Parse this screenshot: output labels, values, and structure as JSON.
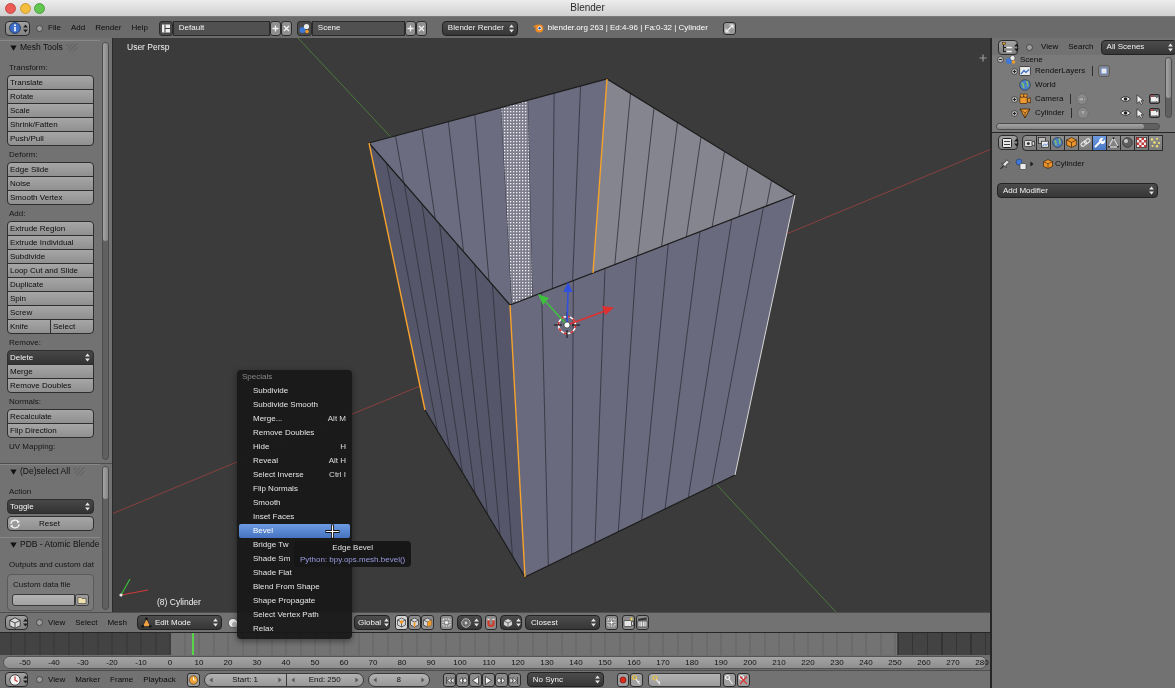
{
  "window": {
    "title": "Blender"
  },
  "info_header": {
    "menus": [
      "File",
      "Add",
      "Render",
      "Help"
    ],
    "screen_layout": "Default",
    "scene": "Scene",
    "render_engine": "Blender Render",
    "stats": "blender.org 263 | Ed:4-96 | Fa:0-32 | Cylinder"
  },
  "tool_shelf": {
    "panels": [
      {
        "title": "Mesh Tools",
        "expanded": true,
        "rows": [
          {
            "kind": "heading",
            "text": "Transform:"
          },
          {
            "kind": "column",
            "items": [
              {
                "kind": "button",
                "label": "Translate"
              },
              {
                "kind": "button",
                "label": "Rotate"
              },
              {
                "kind": "button",
                "label": "Scale"
              },
              {
                "kind": "button",
                "label": "Shrink/Fatten"
              },
              {
                "kind": "button",
                "label": "Push/Pull"
              }
            ]
          },
          {
            "kind": "heading",
            "text": "Deform:"
          },
          {
            "kind": "column",
            "items": [
              {
                "kind": "button",
                "label": "Edge Slide"
              },
              {
                "kind": "button",
                "label": "Noise"
              },
              {
                "kind": "button",
                "label": "Smooth Vertex"
              }
            ]
          },
          {
            "kind": "heading",
            "text": "Add:"
          },
          {
            "kind": "column",
            "items": [
              {
                "kind": "button",
                "label": "Extrude Region"
              },
              {
                "kind": "button",
                "label": "Extrude Individual"
              },
              {
                "kind": "button",
                "label": "Subdivide"
              },
              {
                "kind": "button",
                "label": "Loop Cut and Slide"
              },
              {
                "kind": "button",
                "label": "Duplicate"
              },
              {
                "kind": "button",
                "label": "Spin"
              },
              {
                "kind": "button",
                "label": "Screw"
              },
              {
                "kind": "pair",
                "labels": [
                  "Knife",
                  "Select"
                ]
              }
            ]
          },
          {
            "kind": "heading",
            "text": "Remove:"
          },
          {
            "kind": "column",
            "items": [
              {
                "kind": "dropdown",
                "label": "Delete"
              },
              {
                "kind": "button",
                "label": "Merge"
              },
              {
                "kind": "button",
                "label": "Remove Doubles"
              }
            ]
          },
          {
            "kind": "heading",
            "text": "Normals:"
          },
          {
            "kind": "column",
            "items": [
              {
                "kind": "button",
                "label": "Recalculate"
              },
              {
                "kind": "button",
                "label": "Flip Direction"
              }
            ]
          },
          {
            "kind": "heading",
            "text": "UV Mapping:"
          }
        ]
      },
      {
        "title": "(De)select All",
        "expanded": true,
        "rows": [
          {
            "kind": "heading",
            "text": "Action"
          },
          {
            "kind": "column",
            "items": [
              {
                "kind": "dropdown",
                "label": "Toggle"
              }
            ]
          },
          {
            "kind": "column",
            "items": [
              {
                "kind": "reset",
                "label": "Reset"
              }
            ]
          }
        ]
      },
      {
        "title": "PDB - Atomic Blende",
        "expanded": true,
        "rows": [
          {
            "kind": "heading",
            "text": "Outputs and custom dat"
          },
          {
            "kind": "file_box",
            "label": "Custom data file"
          }
        ]
      }
    ]
  },
  "viewport": {
    "view_name": "User Persp",
    "active_object": "(8) Cylinder"
  },
  "specials_menu": {
    "title": "Specials",
    "items": [
      {
        "label": "Subdivide",
        "selected": false
      },
      {
        "label": "Subdivide Smooth",
        "selected": false
      },
      {
        "label": "Merge...",
        "shortcut": "Alt M",
        "selected": false
      },
      {
        "label": "Remove Doubles",
        "selected": false
      },
      {
        "label": "Hide",
        "shortcut": "H",
        "selected": false
      },
      {
        "label": "Reveal",
        "shortcut": "Alt H",
        "selected": false
      },
      {
        "label": "Select Inverse",
        "shortcut": "Ctrl I",
        "selected": false
      },
      {
        "label": "Flip Normals",
        "selected": false
      },
      {
        "label": "Smooth",
        "selected": false
      },
      {
        "label": "Inset Faces",
        "selected": false
      },
      {
        "label": "Bevel",
        "selected": true
      },
      {
        "label": "Bridge Tw",
        "selected": false
      },
      {
        "label": "Shade Sm",
        "selected": false
      },
      {
        "label": "Shade Flat",
        "selected": false
      },
      {
        "label": "Blend From Shape",
        "selected": false
      },
      {
        "label": "Shape Propagate",
        "selected": false
      },
      {
        "label": "Select Vertex Path",
        "selected": false
      },
      {
        "label": "Relax",
        "selected": false
      }
    ]
  },
  "tooltip": {
    "title": "Edge Bevel",
    "python": "Python: bpy.ops.mesh.bevel()"
  },
  "view3d_header": {
    "menus": [
      "View",
      "Select",
      "Mesh"
    ],
    "mode": "Edit Mode",
    "orientation": "Global",
    "select_modes": [
      {
        "kind": "vertex",
        "selected": true
      },
      {
        "kind": "edge",
        "selected": false
      },
      {
        "kind": "face",
        "selected": false
      }
    ],
    "snap_target": "Closest"
  },
  "timeline": {
    "ruler_labels": [
      "-50",
      "-40",
      "-30",
      "-20",
      "-10",
      "0",
      "10",
      "20",
      "30",
      "40",
      "50",
      "60",
      "70",
      "80",
      "90",
      "100",
      "110",
      "120",
      "130",
      "140",
      "150",
      "160",
      "170",
      "180",
      "190",
      "200",
      "210",
      "220",
      "230",
      "240",
      "250",
      "260",
      "270",
      "280"
    ],
    "playhead": {
      "level": 0.194
    }
  },
  "timeline_header": {
    "menus": [
      "View",
      "Marker",
      "Frame",
      "Playback"
    ],
    "start": "Start: 1",
    "end": "End: 250",
    "current_frame": "8",
    "playback_controls": [
      {
        "kind": "jump_start"
      },
      {
        "kind": "previous_keyframe"
      },
      {
        "kind": "play_reverse"
      },
      {
        "kind": "play"
      },
      {
        "kind": "next_keyframe"
      },
      {
        "kind": "jump_end"
      }
    ],
    "sync": "No Sync"
  },
  "outliner": {
    "menus": [
      "View",
      "Search"
    ],
    "filter": "All Scenes",
    "tree": [
      {
        "kind": "scene",
        "label": "Scene",
        "expanded": true,
        "children": [
          {
            "kind": "render_layers",
            "label": "RenderLayers",
            "expanded": false
          },
          {
            "kind": "world",
            "label": "World"
          },
          {
            "kind": "camera",
            "label": "Camera",
            "expanded": false
          },
          {
            "kind": "mesh",
            "label": "Cylinder",
            "expanded": false
          }
        ]
      }
    ]
  },
  "properties": {
    "tabs": [
      {
        "kind": "render",
        "selected": false
      },
      {
        "kind": "render_layers",
        "selected": false
      },
      {
        "kind": "world",
        "selected": false
      },
      {
        "kind": "object",
        "selected": false
      },
      {
        "kind": "constraints",
        "selected": false
      },
      {
        "kind": "modifiers",
        "selected": true
      },
      {
        "kind": "data",
        "selected": false
      },
      {
        "kind": "material",
        "selected": false
      },
      {
        "kind": "texture",
        "selected": false
      },
      {
        "kind": "particles",
        "selected": false
      }
    ],
    "context": "Cylinder",
    "add_modifier": "Add Modifier"
  }
}
